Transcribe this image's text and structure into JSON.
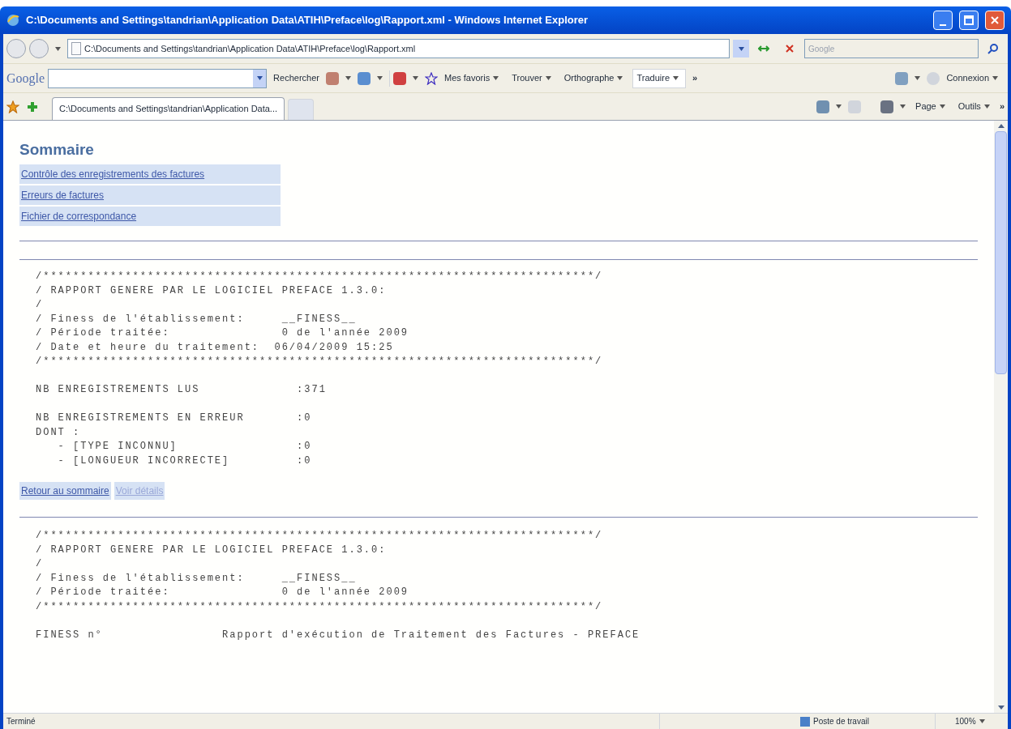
{
  "window": {
    "title": "C:\\Documents and Settings\\tandrian\\Application Data\\ATIH\\Preface\\log\\Rapport.xml - Windows Internet Explorer"
  },
  "address_bar": {
    "value": "C:\\Documents and Settings\\tandrian\\Application Data\\ATIH\\Preface\\log\\Rapport.xml",
    "search_placeholder": "Google"
  },
  "google_toolbar": {
    "logo": "Google",
    "search_button": "Rechercher",
    "items": [
      "Mes favoris",
      "Trouver",
      "Orthographe",
      "Traduire"
    ],
    "more": "»",
    "connect": "Connexion"
  },
  "tabs": [
    {
      "label": "C:\\Documents and Settings\\tandrian\\Application Data...",
      "selected": true
    }
  ],
  "command_bar": {
    "items": [
      "Page",
      "Outils"
    ],
    "more": "»"
  },
  "page": {
    "heading": "Sommaire",
    "toc": [
      "Contrôle des enregistrements des factures",
      "Erreurs de factures",
      "Fichier de correspondance"
    ],
    "reports": [
      {
        "blocks": [
          [
            "/**************************************************************************/",
            "/ RAPPORT GENERE PAR LE LOGICIEL PREFACE 1.3.0:",
            "/",
            "/ Finess de l'établissement:     __FINESS__",
            "/ Période traitée:               0 de l'année 2009",
            "/ Date et heure du traitement:  06/04/2009 15:25",
            "/**************************************************************************/"
          ],
          [
            "NB ENREGISTREMENTS LUS             :371"
          ],
          [
            "NB ENREGISTREMENTS EN ERREUR       :0",
            "DONT :",
            "   - [TYPE INCONNU]                :0",
            "   - [LONGUEUR INCORRECTE]         :0"
          ]
        ],
        "links": [
          "Retour au sommaire",
          "Voir détails"
        ]
      },
      {
        "blocks": [
          [
            "/**************************************************************************/",
            "/ RAPPORT GENERE PAR LE LOGICIEL PREFACE 1.3.0:",
            "/",
            "/ Finess de l'établissement:     __FINESS__",
            "/ Période traitée:               0 de l'année 2009",
            "/**************************************************************************/"
          ],
          [
            "FINESS n°                Rapport d'exécution de Traitement des Factures - PREFACE"
          ]
        ]
      }
    ]
  },
  "status_bar": {
    "status": "Terminé",
    "zone": "Poste de travail",
    "zoom": "100%"
  }
}
